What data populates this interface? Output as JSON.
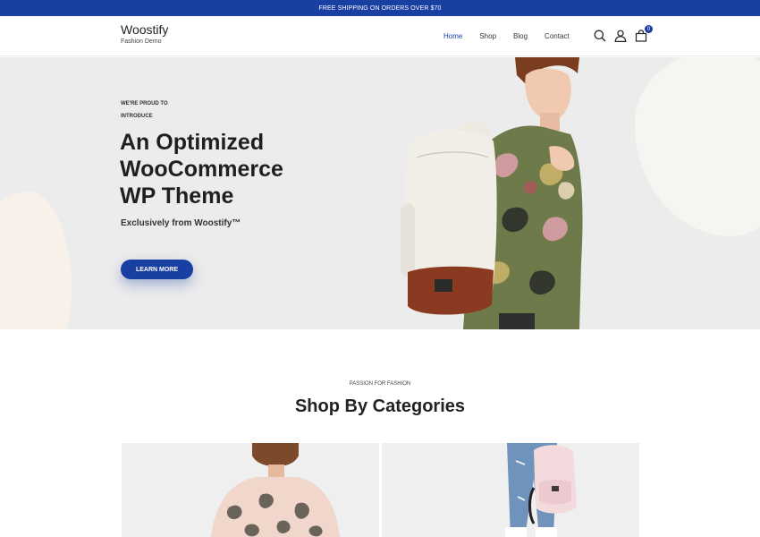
{
  "announcement": "FREE SHIPPING ON ORDERS OVER $70",
  "brand": {
    "name": "Woostify",
    "tagline": "Fashion Demo"
  },
  "nav": {
    "items": [
      {
        "label": "Home",
        "active": true
      },
      {
        "label": "Shop",
        "active": false
      },
      {
        "label": "Blog",
        "active": false
      },
      {
        "label": "Contact",
        "active": false
      }
    ]
  },
  "header_icons": {
    "search": "search-icon",
    "account": "user-icon",
    "cart": "cart-icon",
    "cart_count": "0"
  },
  "hero": {
    "kicker_line1": "WE'RE PROUD TO",
    "kicker_line2": "INTRODUCE",
    "title_line1": "An Optimized",
    "title_line2": "WooCommerce",
    "title_line3": "WP Theme",
    "subtitle": "Exclusively from Woostify™",
    "cta": "LEARN MORE"
  },
  "categories": {
    "kicker": "PASSION FOR FASHION",
    "title": "Shop By Categories"
  },
  "colors": {
    "accent": "#1a3fa3",
    "hero_bg": "#ececec"
  }
}
